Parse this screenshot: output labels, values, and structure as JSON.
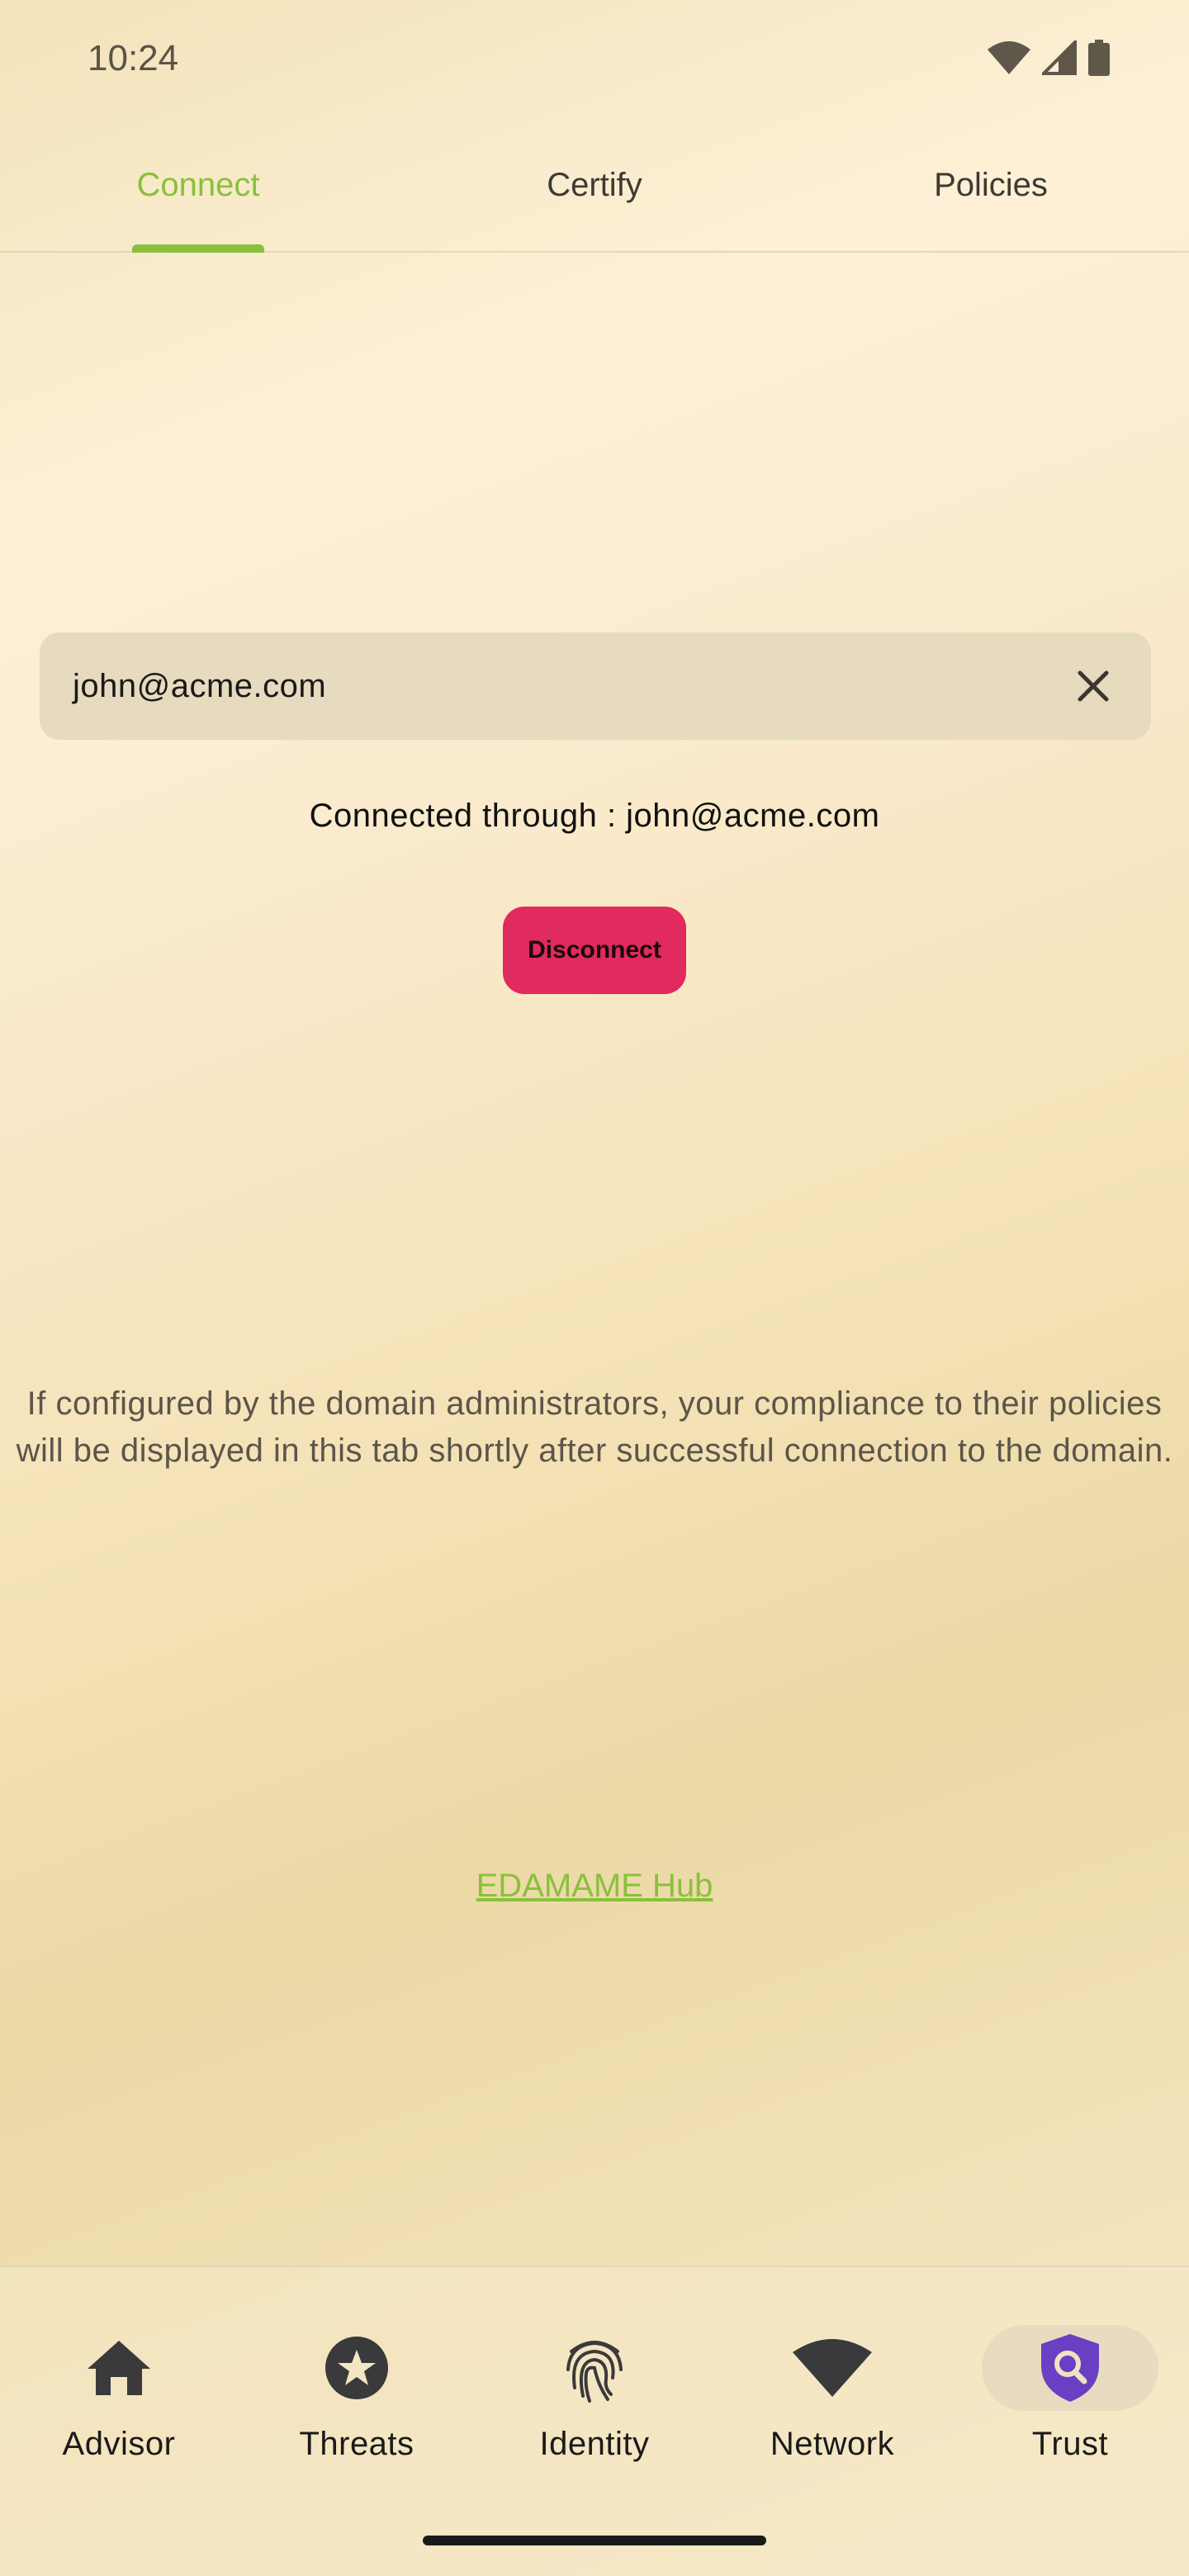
{
  "status_bar": {
    "time": "10:24",
    "icons": [
      "wifi-icon",
      "cellular-signal-icon",
      "battery-icon"
    ]
  },
  "top_tabs": [
    {
      "label": "Connect",
      "active": true
    },
    {
      "label": "Certify",
      "active": false
    },
    {
      "label": "Policies",
      "active": false
    }
  ],
  "connect": {
    "email_value": "john@acme.com",
    "connected_text": "Connected through : john@acme.com",
    "disconnect_label": "Disconnect",
    "info_text": "If configured by the domain administrators, your compliance to their policies will be displayed in this tab shortly after successful connection to the domain.",
    "hub_link": "EDAMAME Hub"
  },
  "bottom_nav": [
    {
      "label": "Advisor",
      "icon": "home-icon",
      "active": false
    },
    {
      "label": "Threats",
      "icon": "star-badge-icon",
      "active": false
    },
    {
      "label": "Identity",
      "icon": "fingerprint-icon",
      "active": false
    },
    {
      "label": "Network",
      "icon": "wifi-icon",
      "active": false
    },
    {
      "label": "Trust",
      "icon": "shield-search-icon",
      "active": true
    }
  ],
  "colors": {
    "accent": "#8ac03c",
    "disconnect": "#e12a5e",
    "trust_icon": "#6b3fc4",
    "nav_icon": "#3a3a3c"
  }
}
